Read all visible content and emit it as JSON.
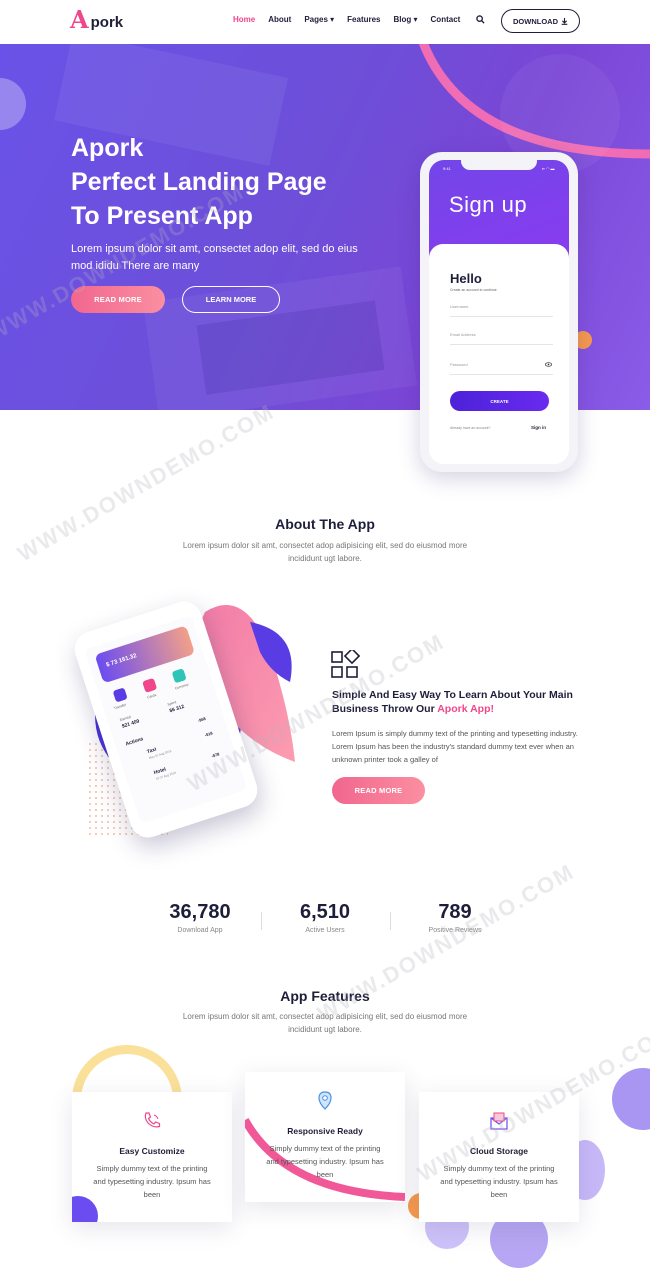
{
  "brand": {
    "mark": "A",
    "name": "pork"
  },
  "nav": {
    "items": [
      {
        "label": "Home",
        "active": true
      },
      {
        "label": "About"
      },
      {
        "label": "Pages ▾"
      },
      {
        "label": "Features"
      },
      {
        "label": "Blog ▾"
      },
      {
        "label": "Contact"
      }
    ],
    "download_label": "DOWNLOAD"
  },
  "hero": {
    "title_line1": "Apork",
    "title_line2": "Perfect Landing Page",
    "title_line3": "To Present App",
    "text": "Lorem ipsum dolor sit amt, consectet adop elit, sed do eius mod ididu There are many",
    "read_more": "READ MORE",
    "learn_more": "LEARN MORE"
  },
  "phone": {
    "time": "9:41",
    "status": "▪▪ ◠ ▬",
    "title": "Sign up",
    "hello": "Hello",
    "hello_sub": "Create an account to continue",
    "username": "Username",
    "email": "Email Address",
    "password": "Password",
    "create": "CREATE",
    "footer": "Already have an account?",
    "signin": "Sign in"
  },
  "about": {
    "title": "About The App",
    "subtitle": "Lorem ipsum dolor sit amt, consectet adop adipisicing elit, sed do eiusmod more incididunt ugt labore.",
    "heading_part1": "Simple And Easy Way To Learn About Your Main Business Throw Our ",
    "heading_highlight": "Apork App!",
    "body": "Lorem Ipsum is simply dummy text of the printing and typesetting industry. Lorem Ipsum has been the industry's standard dummy text ever when an unknown printer took a galley of",
    "read_more": "READ MORE"
  },
  "mini_app": {
    "balance": "$ 73 161.32",
    "tile1": "Transfer",
    "tile2": "Cards",
    "tile3": "Currency",
    "earned_label": "Earned",
    "earned_value": "$21 409",
    "spent_label": "Spent",
    "spent_value": "$6 312",
    "actions": "Actions",
    "row1_title": "Taxi",
    "row1_date": "May 01 Aug 2018",
    "row1_value": "-$18",
    "row2_title": "Hotel",
    "row2_date": "19 07 Aug 2018",
    "row2_value": "-$78",
    "extra_value": "-$68"
  },
  "stats": [
    {
      "number": "36,780",
      "label": "Download App"
    },
    {
      "number": "6,510",
      "label": "Active Users"
    },
    {
      "number": "789",
      "label": "Positive Reviews"
    }
  ],
  "features": {
    "title": "App Features",
    "subtitle": "Lorem ipsum dolor sit amt, consectet adop adipisicing elit, sed do eiusmod more incididunt ugt labore.",
    "cards": [
      {
        "title": "Easy Customize",
        "text": "Simply dummy text of the printing and typesetting industry. Ipsum has been",
        "icon": "phone-icon"
      },
      {
        "title": "Responsive Ready",
        "text": "Simply dummy text of the printing and typesetting industry. Ipsum has been",
        "icon": "location-pin-icon"
      },
      {
        "title": "Cloud Storage",
        "text": "Simply dummy text of the printing and typesetting industry. Ipsum has been",
        "icon": "mail-icon"
      }
    ]
  },
  "watermark": "WWW.DOWNDEMO.COM",
  "colors": {
    "accent": "#f0468c",
    "primary": "#6a52e8",
    "dark": "#1e1e3a"
  }
}
